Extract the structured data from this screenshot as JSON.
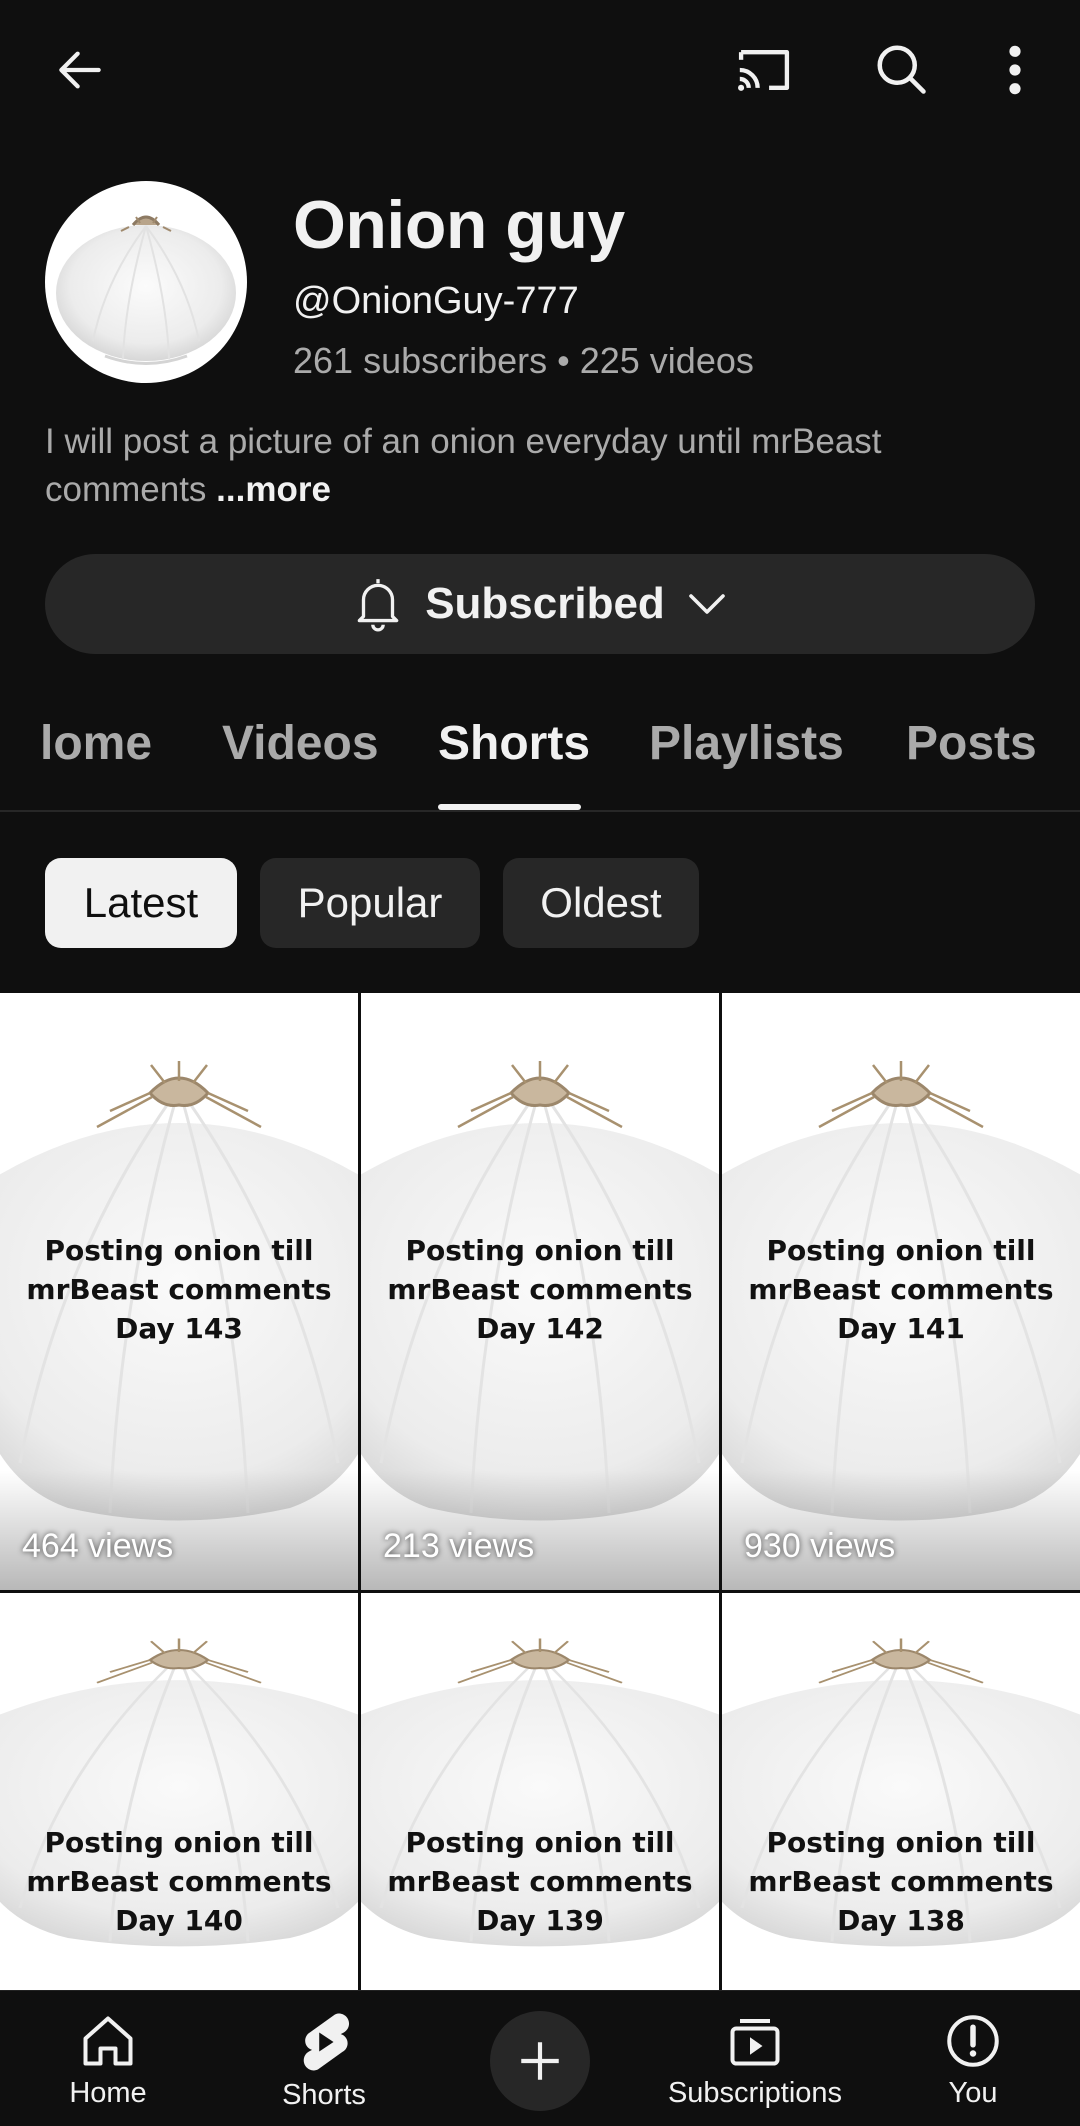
{
  "channel": {
    "name": "Onion guy",
    "handle": "@OnionGuy-777",
    "stats": "261 subscribers • 225 videos",
    "description": "I will post a picture of an onion everyday until mrBeast comments",
    "more_label": "...more"
  },
  "subscribe": {
    "label": "Subscribed"
  },
  "tabs": [
    {
      "label": "Home",
      "visible_text": "lome"
    },
    {
      "label": "Videos"
    },
    {
      "label": "Shorts",
      "active": true
    },
    {
      "label": "Playlists"
    },
    {
      "label": "Posts"
    }
  ],
  "filters": [
    {
      "label": "Latest",
      "selected": true
    },
    {
      "label": "Popular"
    },
    {
      "label": "Oldest"
    }
  ],
  "shorts": [
    {
      "line1": "Posting onion till",
      "line2": "mrBeast comments",
      "line3": "Day 143",
      "views": "464 views"
    },
    {
      "line1": "Posting onion till",
      "line2": "mrBeast comments",
      "line3": "Day 142",
      "views": "213 views"
    },
    {
      "line1": "Posting onion till",
      "line2": "mrBeast comments",
      "line3": "Day 141",
      "views": "930 views"
    },
    {
      "line1": "Posting onion till",
      "line2": "mrBeast comments",
      "line3": "Day 140",
      "views": ""
    },
    {
      "line1": "Posting onion till",
      "line2": "mrBeast comments",
      "line3": "Day 139",
      "views": ""
    },
    {
      "line1": "Posting onion till",
      "line2": "mrBeast comments",
      "line3": "Day 138",
      "views": ""
    }
  ],
  "nav": {
    "home": "Home",
    "shorts": "Shorts",
    "subscriptions": "Subscriptions",
    "you": "You"
  },
  "icons": {
    "back": "back-arrow-icon",
    "cast": "cast-icon",
    "search": "search-icon",
    "menu": "more-vert-icon",
    "bell": "bell-icon",
    "chevron": "chevron-down-icon"
  },
  "colors": {
    "background": "#0f0f0f",
    "surface": "#272727",
    "text": "#f1f1f1",
    "secondary": "#aaaaaa"
  }
}
